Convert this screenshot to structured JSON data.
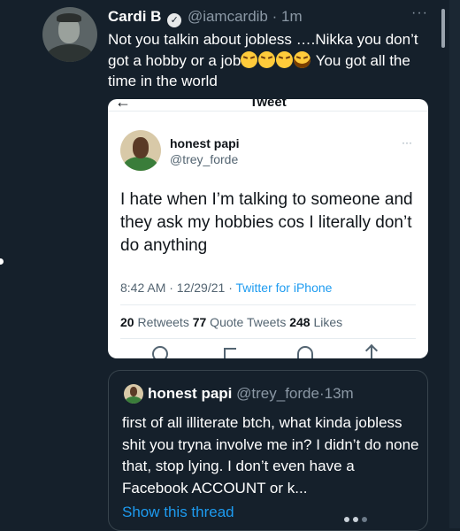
{
  "tweet": {
    "author_name": "Cardi B",
    "handle": "@iamcardib",
    "separator": "·",
    "time": "1m",
    "more_label": "···",
    "text_part1": "Not you talkin about jobless ….Nikka you don’t got a hobby or a job",
    "text_part2": " You got all the time in the world"
  },
  "screenshot": {
    "back_arrow": "←",
    "title": "Tweet",
    "author_name": "honest papi",
    "handle": "@trey_forde",
    "more_label": "···",
    "text": "I hate when I’m talking to someone and they ask my hobbies cos I literally don’t do anything",
    "timestamp": "8:42 AM · 12/29/21 · ",
    "source": "Twitter for iPhone",
    "retweets_count": "20",
    "retweets_label": " Retweets  ",
    "quotes_count": "77",
    "quotes_label": " Quote Tweets  ",
    "likes_count": "248",
    "likes_label": " Likes"
  },
  "quoted": {
    "author_name": "honest papi",
    "handle": "@trey_forde",
    "separator": "·",
    "time": "13m",
    "text": "first of all illiterate btch, what kinda jobless shit you tryna involve me in? I didn’t do none that, stop lying. I don’t even have a Facebook ACCOUNT or k...",
    "show_thread": "Show this thread"
  },
  "icons": {
    "verified": "verified-badge-icon",
    "emoji_weary": "weary-face-emoji",
    "emoji_laugh": "tears-of-joy-emoji"
  },
  "colors": {
    "background": "#15202b",
    "accent": "#1d9bf0",
    "muted": "#8b98a5"
  }
}
